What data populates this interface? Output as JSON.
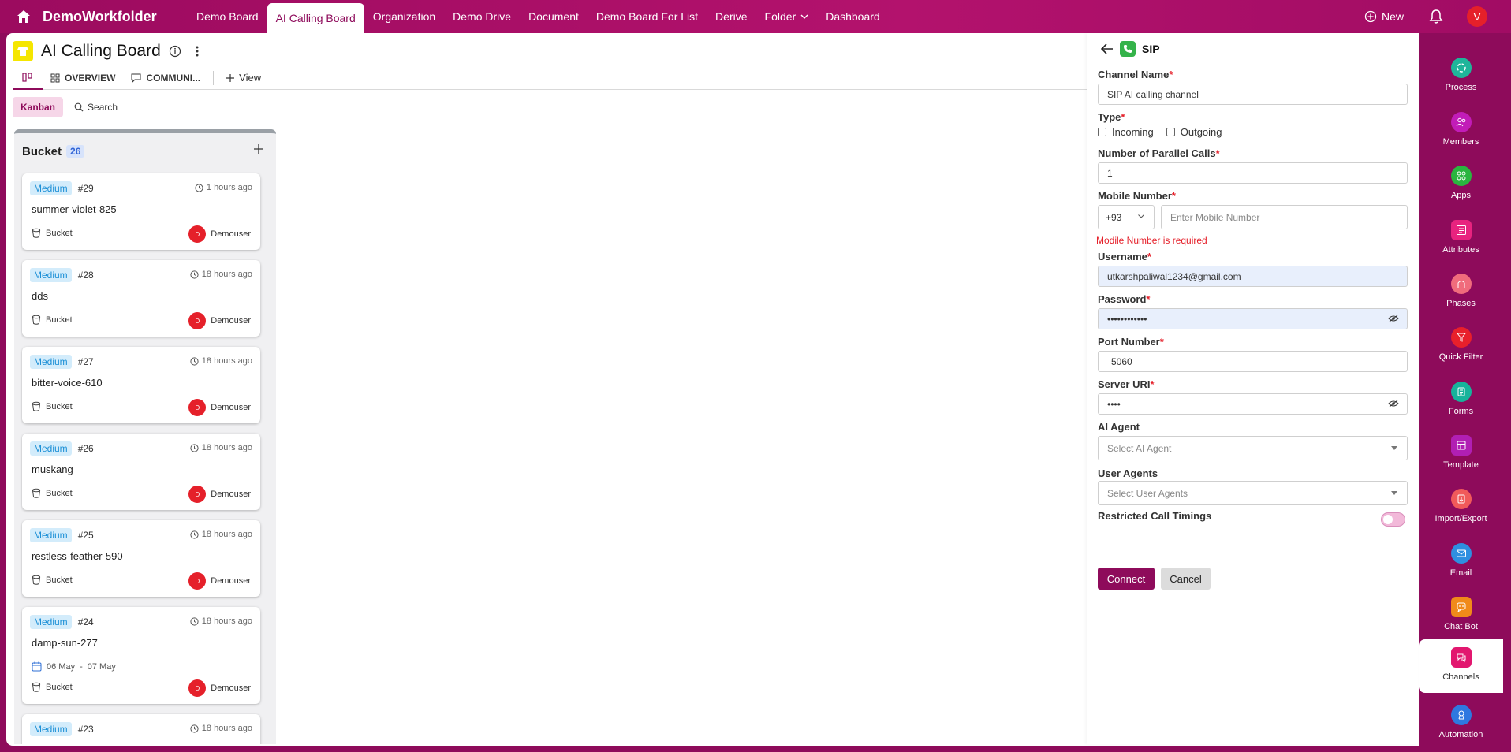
{
  "topbar": {
    "brand": "DemoWorkfolder",
    "tabs": [
      {
        "label": "Demo Board"
      },
      {
        "label": "AI Calling Board",
        "active": true
      },
      {
        "label": "Organization"
      },
      {
        "label": "Demo Drive"
      },
      {
        "label": "Document"
      },
      {
        "label": "Demo Board For List"
      },
      {
        "label": "Derive"
      },
      {
        "label": "Folder"
      },
      {
        "label": "Dashboard"
      }
    ],
    "new_label": "New",
    "avatar_initial": "V"
  },
  "board": {
    "title": "AI Calling Board",
    "view_tabs": [
      "OVERVIEW",
      "COMMUNI..."
    ],
    "add_view": "View",
    "kanban_label": "Kanban",
    "search_label": "Search"
  },
  "column": {
    "title": "Bucket",
    "count": "26",
    "cards": [
      {
        "priority": "Medium",
        "id": "#29",
        "time": "1 hours ago",
        "name": "summer-violet-825",
        "bucket": "Bucket",
        "user": "Demouser",
        "user_initial": "D"
      },
      {
        "priority": "Medium",
        "id": "#28",
        "time": "18 hours ago",
        "name": "dds",
        "bucket": "Bucket",
        "user": "Demouser",
        "user_initial": "D"
      },
      {
        "priority": "Medium",
        "id": "#27",
        "time": "18 hours ago",
        "name": "bitter-voice-610",
        "bucket": "Bucket",
        "user": "Demouser",
        "user_initial": "D"
      },
      {
        "priority": "Medium",
        "id": "#26",
        "time": "18 hours ago",
        "name": "muskang",
        "bucket": "Bucket",
        "user": "Demouser",
        "user_initial": "D"
      },
      {
        "priority": "Medium",
        "id": "#25",
        "time": "18 hours ago",
        "name": "restless-feather-590",
        "bucket": "Bucket",
        "user": "Demouser",
        "user_initial": "D"
      },
      {
        "priority": "Medium",
        "id": "#24",
        "time": "18 hours ago",
        "name": "damp-sun-277",
        "date_start": "06 May",
        "date_sep": "-",
        "date_end": "07 May",
        "bucket": "Bucket",
        "user": "Demouser",
        "user_initial": "D"
      },
      {
        "priority": "Medium",
        "id": "#23",
        "time": "18 hours ago"
      }
    ]
  },
  "sip_form": {
    "title": "SIP",
    "channel_name_label": "Channel Name",
    "channel_name_value": "SIP AI calling channel",
    "type_label": "Type",
    "type_options": [
      "Incoming",
      "Outgoing"
    ],
    "parallel_calls_label": "Number of Parallel Calls",
    "parallel_calls_value": "1",
    "mobile_label": "Mobile Number",
    "country_code": "+93",
    "mobile_placeholder": "Enter Mobile Number",
    "mobile_error": "Modile Number is required",
    "username_label": "Username",
    "username_value": "utkarshpaliwal1234@gmail.com",
    "password_label": "Password",
    "password_value": "••••••••••••",
    "port_label": "Port Number",
    "port_value": "5060",
    "server_uri_label": "Server URI",
    "server_uri_value": "••••",
    "ai_agent_label": "AI Agent",
    "ai_agent_placeholder": "Select AI Agent",
    "user_agents_label": "User Agents",
    "user_agents_placeholder": "Select User Agents",
    "restricted_label": "Restricted Call Timings",
    "restricted_enabled": false,
    "connect_label": "Connect",
    "cancel_label": "Cancel"
  },
  "right_sidebar": {
    "items": [
      {
        "label": "Process",
        "icon": "process-icon",
        "color": "#1fb59a"
      },
      {
        "label": "Members",
        "icon": "members-icon",
        "color": "#c21cb8"
      },
      {
        "label": "Apps",
        "icon": "apps-icon",
        "color": "#2ab53f"
      },
      {
        "label": "Attributes",
        "icon": "attributes-icon",
        "color": "#e8237f"
      },
      {
        "label": "Phases",
        "icon": "phases-icon",
        "color": "#f06c7c"
      },
      {
        "label": "Quick Filter",
        "icon": "filter-icon",
        "color": "#e8202b"
      },
      {
        "label": "Forms",
        "icon": "forms-icon",
        "color": "#17b39b"
      },
      {
        "label": "Template",
        "icon": "template-icon",
        "color": "#b11fb3"
      },
      {
        "label": "Import/Export",
        "icon": "import-export-icon",
        "color": "#f05a5a"
      },
      {
        "label": "Email",
        "icon": "email-icon",
        "color": "#2e8fe0"
      },
      {
        "label": "Chat Bot",
        "icon": "chatbot-icon",
        "color": "#f08a1a"
      },
      {
        "label": "Channels",
        "icon": "channels-icon",
        "color": "#e2176f",
        "active": true
      },
      {
        "label": "Automation",
        "icon": "automation-icon",
        "color": "#2e78e0"
      }
    ]
  },
  "colors": {
    "brand": "#8e0b5b",
    "accent_badge": "#d3ecfb",
    "error": "#e5202a"
  }
}
